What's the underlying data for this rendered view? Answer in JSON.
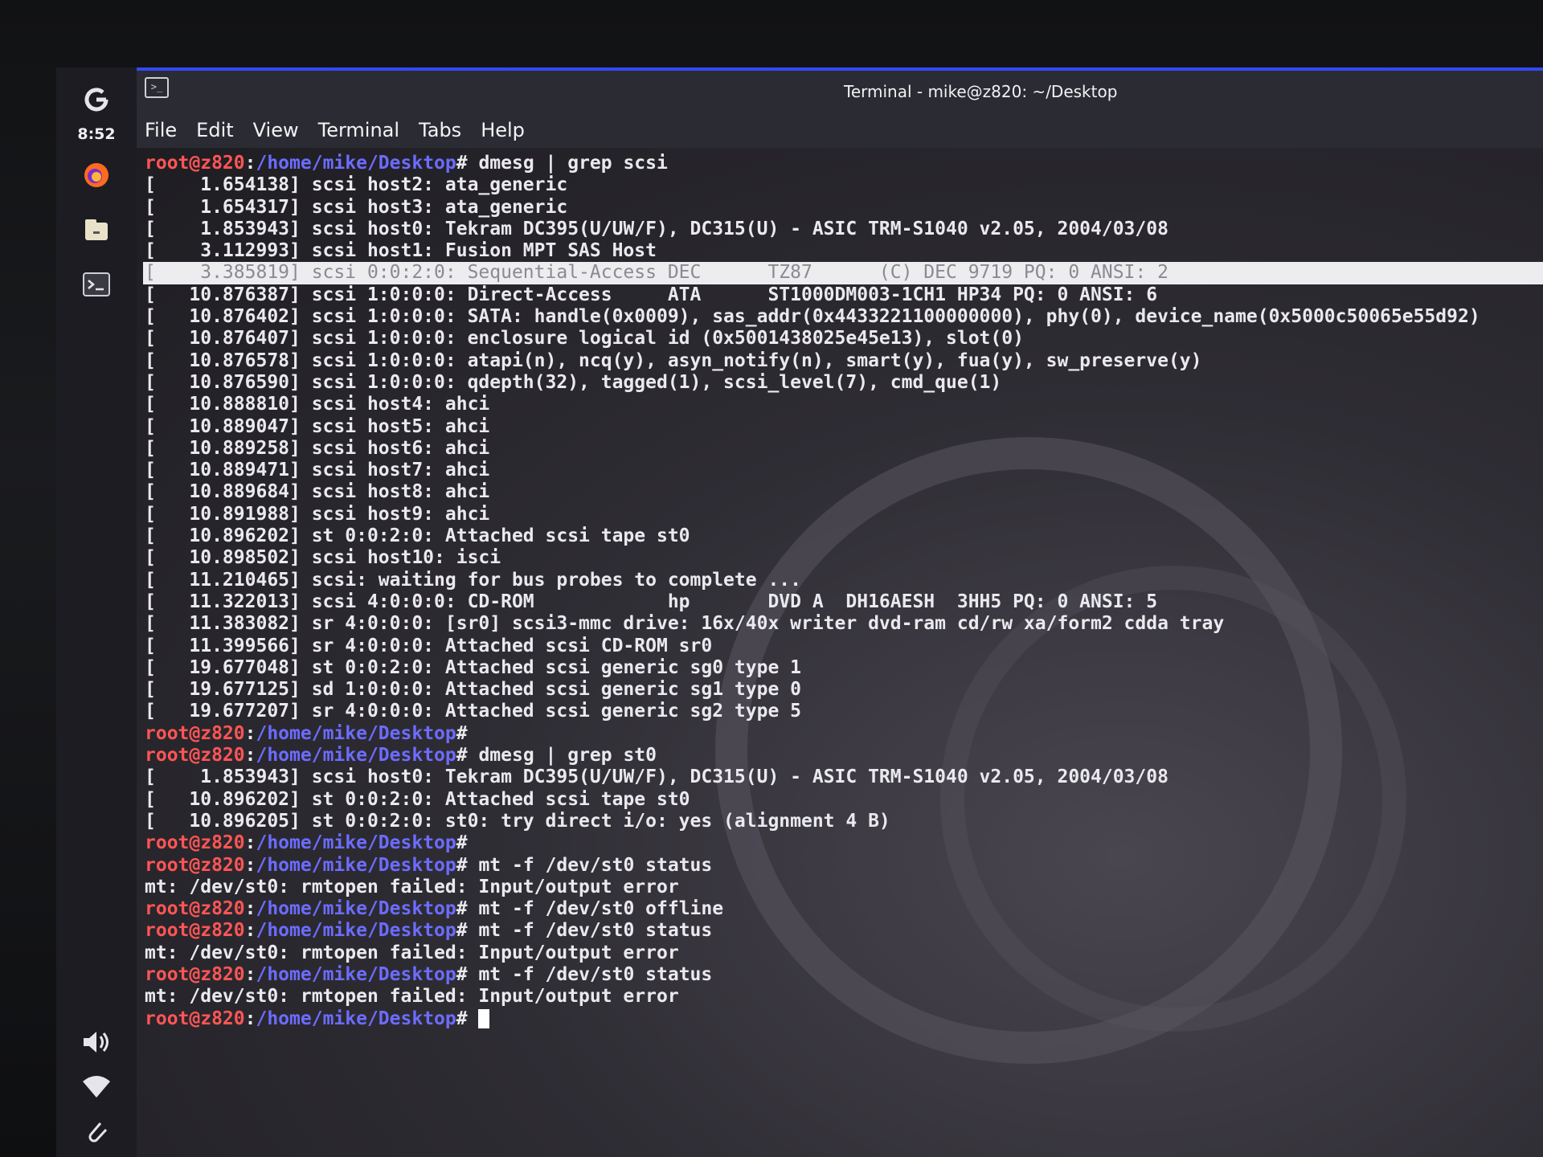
{
  "taskbar": {
    "clock": "8:52",
    "icons": [
      "app-menu-icon",
      "firefox-icon",
      "files-icon",
      "terminal-icon"
    ],
    "tray": [
      "volume-icon",
      "wifi-icon",
      "clip-icon"
    ]
  },
  "window": {
    "title": "Terminal - mike@z820: ~/Desktop",
    "menu": [
      "File",
      "Edit",
      "View",
      "Terminal",
      "Tabs",
      "Help"
    ]
  },
  "prompt": {
    "user": "root@z820",
    "path": "/home/mike/Desktop",
    "sep": ":",
    "sym": "#"
  },
  "lines": [
    {
      "type": "prompt",
      "cmd": " dmesg | grep scsi"
    },
    {
      "type": "out",
      "text": "[    1.654138] scsi host2: ata_generic"
    },
    {
      "type": "out",
      "text": "[    1.654317] scsi host3: ata_generic"
    },
    {
      "type": "out",
      "text": "[    1.853943] scsi host0: Tekram DC395(U/UW/F), DC315(U) - ASIC TRM-S1040 v2.05, 2004/03/08"
    },
    {
      "type": "out",
      "text": "[    3.112993] scsi host1: Fusion MPT SAS Host"
    },
    {
      "type": "highlight",
      "text": "[    3.385819] scsi 0:0:2:0: Sequential-Access DEC      TZ87      (C) DEC 9719 PQ: 0 ANSI: 2"
    },
    {
      "type": "out",
      "text": "[   10.876387] scsi 1:0:0:0: Direct-Access     ATA      ST1000DM003-1CH1 HP34 PQ: 0 ANSI: 6"
    },
    {
      "type": "out",
      "text": "[   10.876402] scsi 1:0:0:0: SATA: handle(0x0009), sas_addr(0x4433221100000000), phy(0), device_name(0x5000c50065e55d92)"
    },
    {
      "type": "out",
      "text": "[   10.876407] scsi 1:0:0:0: enclosure logical id (0x5001438025e45e13), slot(0)"
    },
    {
      "type": "out",
      "text": "[   10.876578] scsi 1:0:0:0: atapi(n), ncq(y), asyn_notify(n), smart(y), fua(y), sw_preserve(y)"
    },
    {
      "type": "out",
      "text": "[   10.876590] scsi 1:0:0:0: qdepth(32), tagged(1), scsi_level(7), cmd_que(1)"
    },
    {
      "type": "out",
      "text": "[   10.888810] scsi host4: ahci"
    },
    {
      "type": "out",
      "text": "[   10.889047] scsi host5: ahci"
    },
    {
      "type": "out",
      "text": "[   10.889258] scsi host6: ahci"
    },
    {
      "type": "out",
      "text": "[   10.889471] scsi host7: ahci"
    },
    {
      "type": "out",
      "text": "[   10.889684] scsi host8: ahci"
    },
    {
      "type": "out",
      "text": "[   10.891988] scsi host9: ahci"
    },
    {
      "type": "out",
      "text": "[   10.896202] st 0:0:2:0: Attached scsi tape st0"
    },
    {
      "type": "out",
      "text": "[   10.898502] scsi host10: isci"
    },
    {
      "type": "out",
      "text": "[   11.210465] scsi: waiting for bus probes to complete ..."
    },
    {
      "type": "out",
      "text": "[   11.322013] scsi 4:0:0:0: CD-ROM            hp       DVD A  DH16AESH  3HH5 PQ: 0 ANSI: 5"
    },
    {
      "type": "out",
      "text": "[   11.383082] sr 4:0:0:0: [sr0] scsi3-mmc drive: 16x/40x writer dvd-ram cd/rw xa/form2 cdda tray"
    },
    {
      "type": "out",
      "text": "[   11.399566] sr 4:0:0:0: Attached scsi CD-ROM sr0"
    },
    {
      "type": "out",
      "text": "[   19.677048] st 0:0:2:0: Attached scsi generic sg0 type 1"
    },
    {
      "type": "out",
      "text": "[   19.677125] sd 1:0:0:0: Attached scsi generic sg1 type 0"
    },
    {
      "type": "out",
      "text": "[   19.677207] sr 4:0:0:0: Attached scsi generic sg2 type 5"
    },
    {
      "type": "prompt",
      "cmd": ""
    },
    {
      "type": "prompt",
      "cmd": " dmesg | grep st0"
    },
    {
      "type": "out",
      "text": "[    1.853943] scsi host0: Tekram DC395(U/UW/F), DC315(U) - ASIC TRM-S1040 v2.05, 2004/03/08"
    },
    {
      "type": "out",
      "text": "[   10.896202] st 0:0:2:0: Attached scsi tape st0"
    },
    {
      "type": "out",
      "text": "[   10.896205] st 0:0:2:0: st0: try direct i/o: yes (alignment 4 B)"
    },
    {
      "type": "prompt",
      "cmd": ""
    },
    {
      "type": "prompt",
      "cmd": " mt -f /dev/st0 status"
    },
    {
      "type": "out",
      "text": "mt: /dev/st0: rmtopen failed: Input/output error"
    },
    {
      "type": "prompt",
      "cmd": " mt -f /dev/st0 offline"
    },
    {
      "type": "prompt",
      "cmd": " mt -f /dev/st0 status"
    },
    {
      "type": "out",
      "text": "mt: /dev/st0: rmtopen failed: Input/output error"
    },
    {
      "type": "prompt",
      "cmd": " mt -f /dev/st0 status"
    },
    {
      "type": "out",
      "text": "mt: /dev/st0: rmtopen failed: Input/output error"
    },
    {
      "type": "cursor",
      "cmd": " "
    }
  ]
}
